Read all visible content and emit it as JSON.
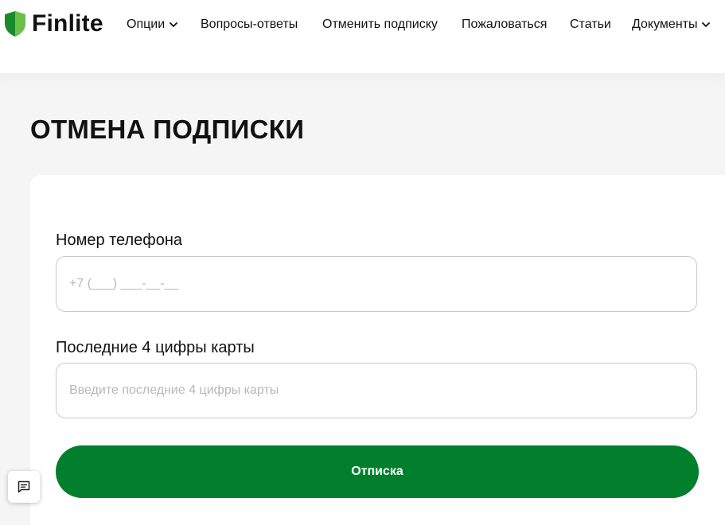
{
  "brand": {
    "name": "Finlite",
    "colors": {
      "shield_dark": "#1b8a2b",
      "shield_light": "#6cc04a",
      "accent": "#027f2d"
    }
  },
  "nav": {
    "items": [
      {
        "label": "Опции",
        "has_dropdown": true
      },
      {
        "label": "Вопросы-ответы",
        "has_dropdown": false
      },
      {
        "label": "Отменить подписку",
        "has_dropdown": false
      },
      {
        "label": "Пожаловаться",
        "has_dropdown": false
      },
      {
        "label": "Статьи",
        "has_dropdown": false
      },
      {
        "label": "Документы",
        "has_dropdown": true
      }
    ]
  },
  "page": {
    "title": "ОТМЕНА ПОДПИСКИ"
  },
  "form": {
    "phone": {
      "label": "Номер телефона",
      "placeholder": "+7 (___) ___-__-__",
      "value": ""
    },
    "card": {
      "label": "Последние 4 цифры карты",
      "placeholder": "Введите последние 4 цифры карты",
      "value": ""
    },
    "submit_label": "Отписка"
  },
  "widgets": {
    "chat_icon": "chat-bubble-icon"
  }
}
